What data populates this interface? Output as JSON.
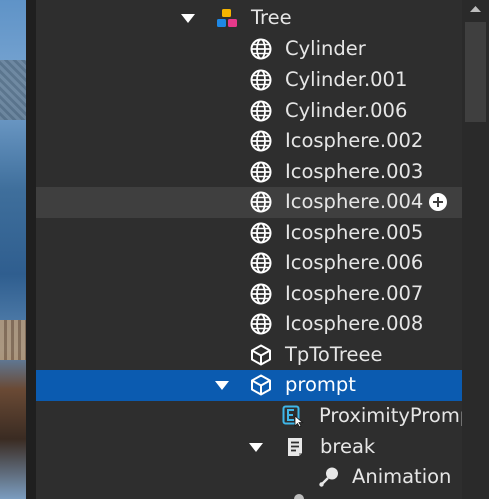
{
  "explorer": {
    "rows": [
      {
        "label": "Tree",
        "icon": "model-icon",
        "arrow": true
      },
      {
        "label": "Cylinder",
        "icon": "globe-mesh-icon"
      },
      {
        "label": "Cylinder.001",
        "icon": "globe-mesh-icon"
      },
      {
        "label": "Cylinder.006",
        "icon": "globe-mesh-icon"
      },
      {
        "label": "Icosphere.002",
        "icon": "globe-mesh-icon"
      },
      {
        "label": "Icosphere.003",
        "icon": "globe-mesh-icon"
      },
      {
        "label": "Icosphere.004",
        "icon": "globe-mesh-icon",
        "state": "hover"
      },
      {
        "label": "Icosphere.005",
        "icon": "globe-mesh-icon"
      },
      {
        "label": "Icosphere.006",
        "icon": "globe-mesh-icon"
      },
      {
        "label": "Icosphere.007",
        "icon": "globe-mesh-icon"
      },
      {
        "label": "Icosphere.008",
        "icon": "globe-mesh-icon"
      },
      {
        "label": "TpToTreee",
        "icon": "part-cube-icon"
      },
      {
        "label": "prompt",
        "icon": "part-cube-icon",
        "arrow": true,
        "state": "selected"
      },
      {
        "label": "ProximityPromp",
        "icon": "proximity-prompt-icon"
      },
      {
        "label": "break",
        "icon": "script-icon",
        "arrow": true
      },
      {
        "label": "Animation",
        "icon": "animation-icon"
      }
    ]
  },
  "colors": {
    "panel_bg": "#2e2e2e",
    "selected_bg": "#0b5bb0",
    "hover_bg": "#3f3f3f",
    "text": "#e6e6e6"
  }
}
